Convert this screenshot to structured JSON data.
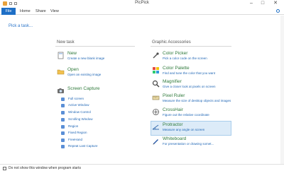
{
  "window": {
    "title": "PicPick",
    "controls": {
      "minimize": "–",
      "maximize": "□",
      "close": "✕"
    }
  },
  "ribbon": {
    "tabs": [
      {
        "label": "File"
      },
      {
        "label": "Home"
      },
      {
        "label": "Share"
      },
      {
        "label": "View"
      }
    ]
  },
  "main": {
    "pick_task": "Pick a task...",
    "new_task": {
      "title": "New task",
      "items": [
        {
          "name": "New",
          "desc": "Create a new blank image",
          "icon": "new-image-icon"
        },
        {
          "name": "Open",
          "desc": "Open an existing image",
          "icon": "open-folder-icon"
        },
        {
          "name": "Screen Capture",
          "desc": "",
          "icon": "camera-icon"
        }
      ],
      "capture_options": [
        {
          "label": "Full screen",
          "icon": "full-screen-icon"
        },
        {
          "label": "Active Window",
          "icon": "active-window-icon"
        },
        {
          "label": "Window Control",
          "icon": "window-control-icon"
        },
        {
          "label": "Scrolling Window",
          "icon": "scrolling-window-icon"
        },
        {
          "label": "Region",
          "icon": "region-icon"
        },
        {
          "label": "Fixed Region",
          "icon": "fixed-region-icon"
        },
        {
          "label": "FreeHand",
          "icon": "freehand-icon"
        },
        {
          "label": "Repeat Last Capture",
          "icon": "repeat-icon"
        }
      ]
    },
    "accessories": {
      "title": "Graphic Accessories",
      "items": [
        {
          "name": "Color Picker",
          "desc": "Pick a color code on the screen",
          "icon": "color-picker-icon"
        },
        {
          "name": "Color Palette",
          "desc": "Find and tune the color that you want",
          "icon": "color-palette-icon"
        },
        {
          "name": "Magnifier",
          "desc": "Give a closer look at pixels on screen",
          "icon": "magnifier-icon"
        },
        {
          "name": "Pixel Ruler",
          "desc": "Measure the size of desktop objects and images",
          "icon": "ruler-icon"
        },
        {
          "name": "CrossHair",
          "desc": "Figure out the relative coordinate",
          "icon": "crosshair-icon"
        },
        {
          "name": "Protractor",
          "desc": "Measure any angle on screen",
          "icon": "protractor-icon"
        },
        {
          "name": "Whiteboard",
          "desc": "For presentation or drawing somet...",
          "icon": "whiteboard-icon"
        }
      ]
    }
  },
  "status": {
    "checkbox_label": "Do not show this window when program starts",
    "checked": false
  },
  "colors": {
    "accent": "#1e6fc6",
    "link": "#1f66b5",
    "item_name": "#2f7a3b",
    "highlight": "#dcebf8"
  }
}
